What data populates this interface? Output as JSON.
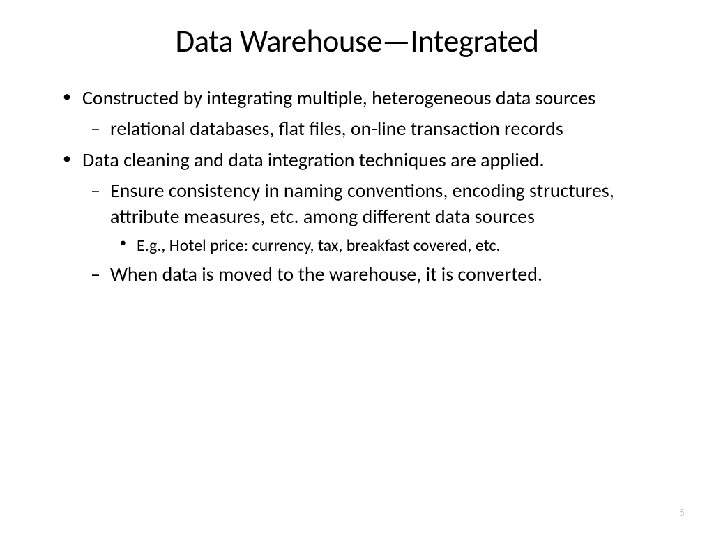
{
  "slide": {
    "title": "Data Warehouse—Integrated",
    "bullets": {
      "b1": "Constructed by integrating multiple, heterogeneous data sources",
      "b1_1": "relational databases, flat files, on-line transaction records",
      "b2": "Data cleaning and data integration techniques are applied.",
      "b2_1": "Ensure consistency in naming conventions, encoding structures, attribute measures, etc. among different data sources",
      "b2_1_1": "E.g., Hotel price: currency, tax, breakfast covered, etc.",
      "b2_2": "When data is moved to the warehouse, it is converted."
    },
    "page_number": "5"
  }
}
